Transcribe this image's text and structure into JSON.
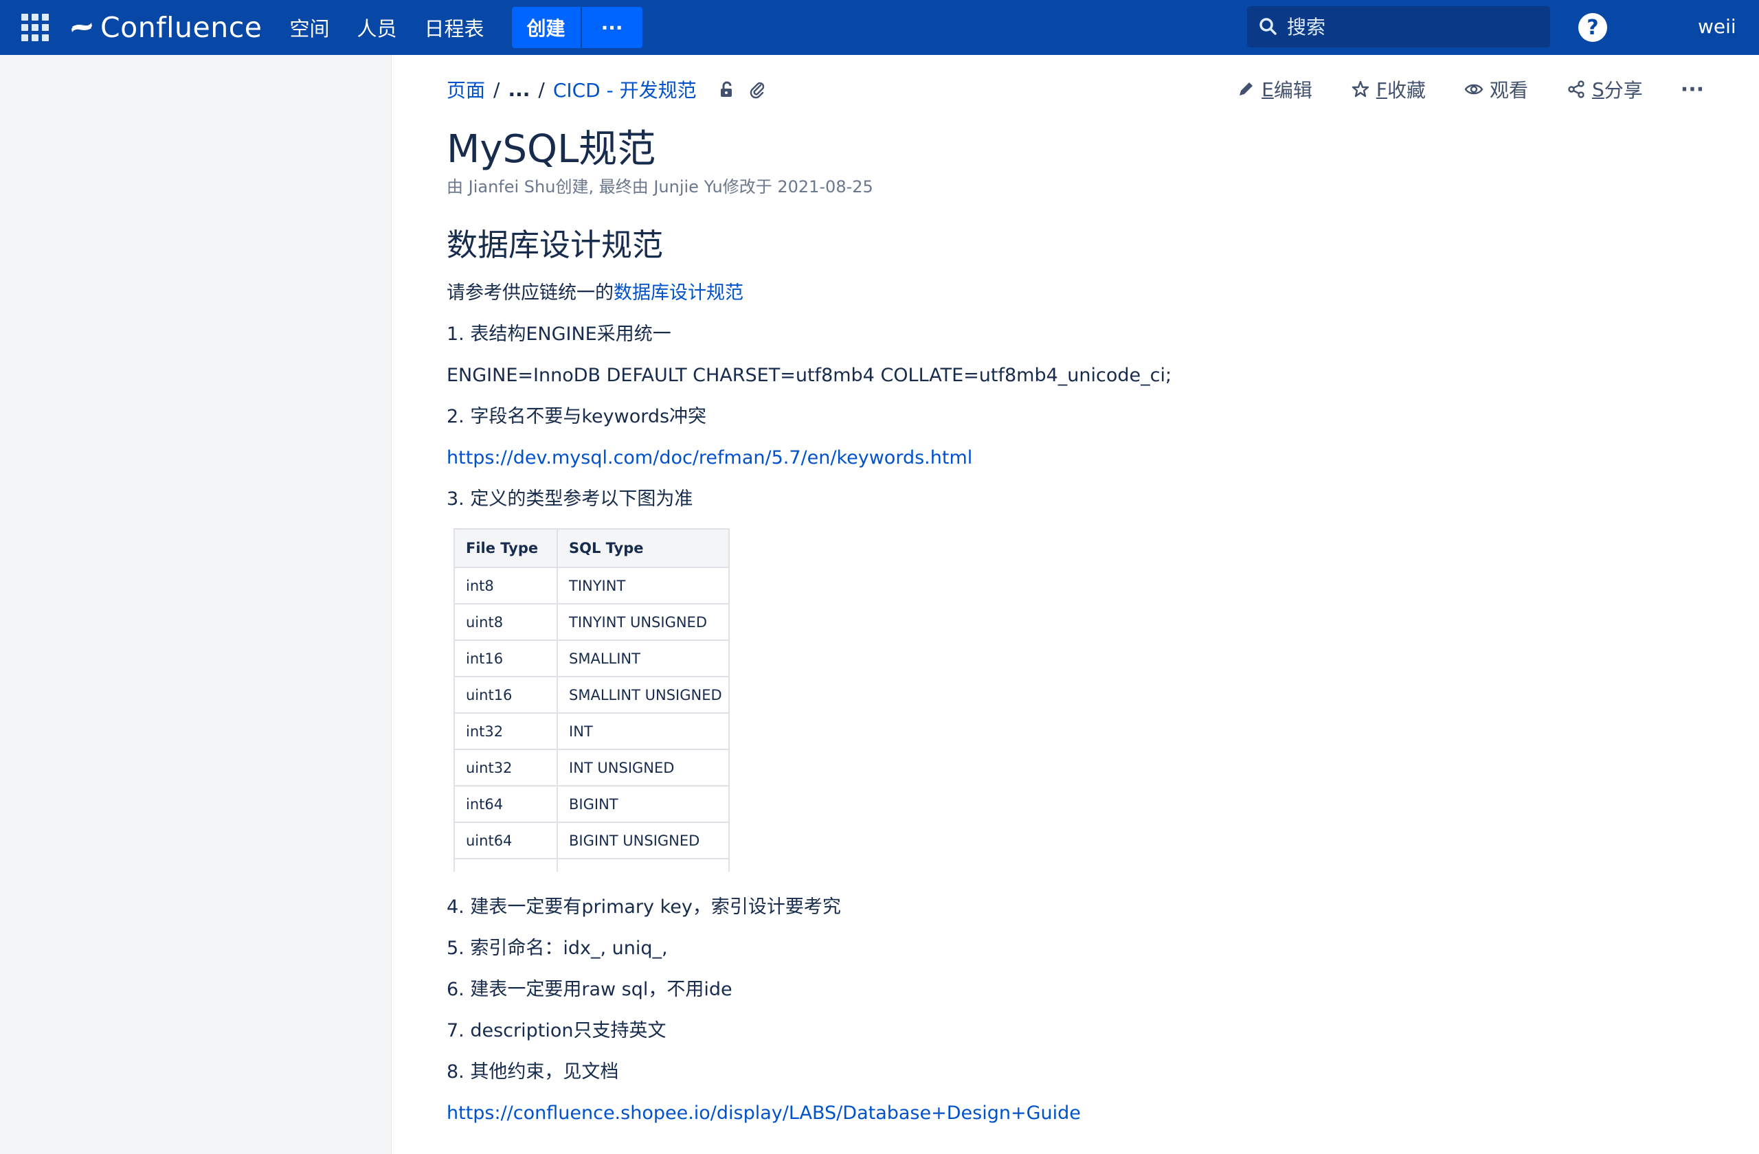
{
  "topbar": {
    "product": "Confluence",
    "nav": [
      "空间",
      "人员",
      "日程表"
    ],
    "create_label": "创建",
    "more_label": "···",
    "search_placeholder": "搜索",
    "help_label": "?",
    "user": "weii"
  },
  "breadcrumbs": {
    "root": "页面",
    "ellipsis": "...",
    "parent": "CICD - 开发规范"
  },
  "actions": {
    "edit": {
      "key": "E",
      "label": "编辑"
    },
    "favorite": {
      "key": "F",
      "label": "收藏"
    },
    "watch": {
      "label": "观看"
    },
    "share": {
      "key": "S",
      "label": "分享"
    },
    "more": "···"
  },
  "page": {
    "title": "MySQL规范",
    "meta": "由 Jianfei Shu创建, 最终由 Junjie Yu修改于 2021-08-25"
  },
  "content": {
    "heading": "数据库设计规范",
    "intro_text": "请参考供应链统一的",
    "intro_link": "数据库设计规范",
    "item1": "1. 表结构ENGINE采用统一",
    "engine": "ENGINE=InnoDB DEFAULT CHARSET=utf8mb4 COLLATE=utf8mb4_unicode_ci;",
    "item2": "2. 字段名不要与keywords冲突",
    "keywords_link": "https://dev.mysql.com/doc/refman/5.7/en/keywords.html",
    "item3": "3. 定义的类型参考以下图为准",
    "type_table": {
      "headers": [
        "File Type",
        "SQL Type"
      ],
      "rows": [
        [
          "int8",
          "TINYINT"
        ],
        [
          "uint8",
          "TINYINT UNSIGNED"
        ],
        [
          "int16",
          "SMALLINT"
        ],
        [
          "uint16",
          "SMALLINT UNSIGNED"
        ],
        [
          "int32",
          "INT"
        ],
        [
          "uint32",
          "INT UNSIGNED"
        ],
        [
          "int64",
          "BIGINT"
        ],
        [
          "uint64",
          "BIGINT UNSIGNED"
        ]
      ]
    },
    "item4": "4. 建表一定要有primary key，索引设计要考究",
    "item5": "5. 索引命名：idx_, uniq_,",
    "item6": "6. 建表一定要用raw sql，不用ide",
    "item7": "7. description只支持英文",
    "item8": "8. 其他约束，见文档",
    "guide_link": "https://confluence.shopee.io/display/LABS/Database+Design+Guide"
  },
  "colors": {
    "topbar": "#0747a6",
    "create": "#0065ff",
    "link": "#0052cc",
    "text": "#172b4d",
    "sidebar": "#f4f5f7"
  }
}
